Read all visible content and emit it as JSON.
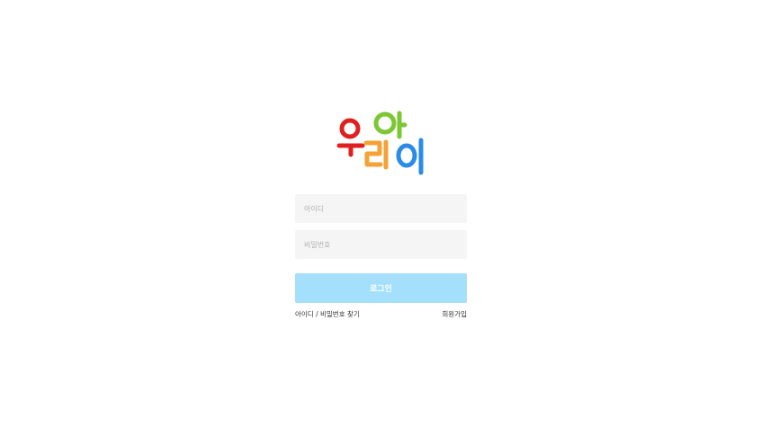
{
  "logo": {
    "text": "우리아이",
    "colors": {
      "u": "#e02020",
      "ri": "#f4a236",
      "a": "#7cc734",
      "i": "#2b8ce6"
    }
  },
  "login_form": {
    "id_placeholder": "아이디",
    "id_value": "",
    "password_placeholder": "비밀번호",
    "password_value": "",
    "login_label": "로그인",
    "find_label": "아이디 / 비밀번호 찾기",
    "signup_label": "회원가입",
    "button_color": "#a4dffb",
    "field_color": "#f5f5f5"
  }
}
